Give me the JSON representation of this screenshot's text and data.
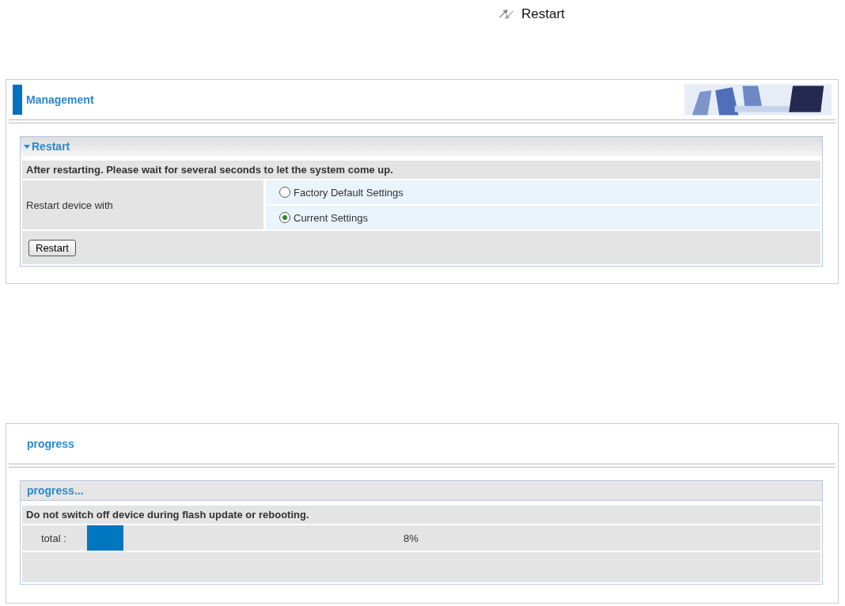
{
  "page_heading": {
    "title": "Restart"
  },
  "management_panel": {
    "title": "Management",
    "section": {
      "title": "Restart",
      "expanded": true,
      "notice": "After restarting. Please wait for several seconds to let the system come up.",
      "field_label": "Restart device with",
      "options": [
        {
          "label": "Factory Default Settings",
          "selected": false
        },
        {
          "label": "Current Settings",
          "selected": true
        }
      ],
      "button": "Restart"
    }
  },
  "progress_panel": {
    "title": "progress",
    "section": {
      "title": "progress...",
      "notice": "Do not switch off device during flash update or rebooting.",
      "label": "total :",
      "level": 0.08,
      "reading": "8%"
    }
  }
}
